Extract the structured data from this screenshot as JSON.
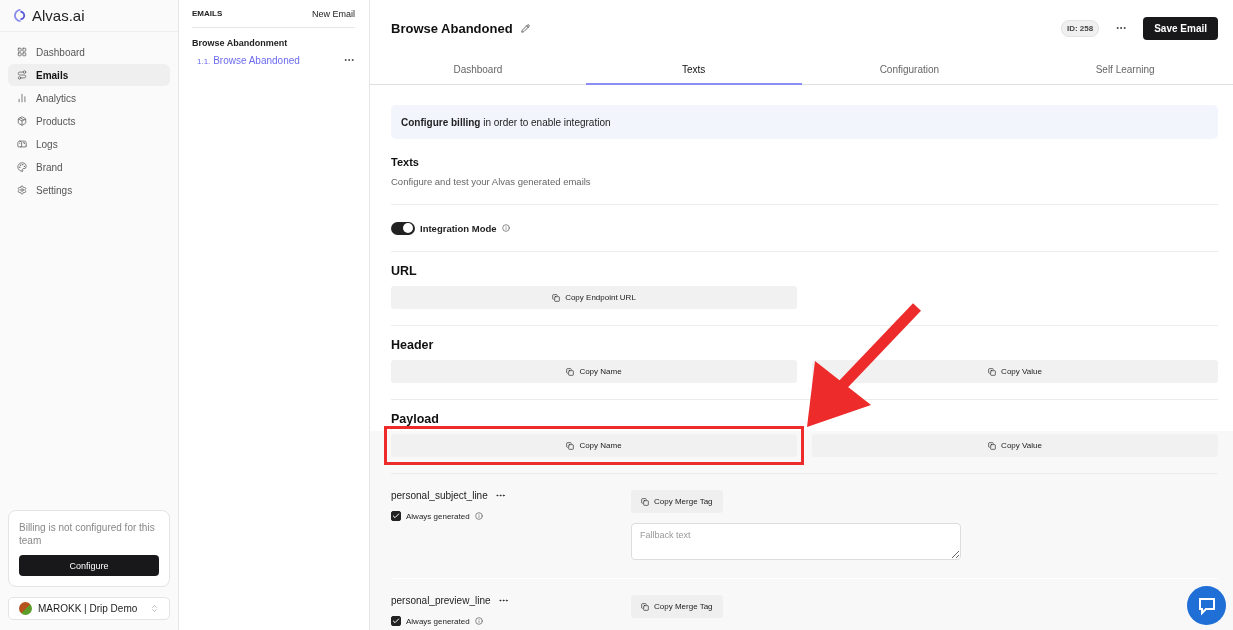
{
  "brand": {
    "name": "Alvas.ai"
  },
  "nav": [
    {
      "label": "Dashboard",
      "selected": false
    },
    {
      "label": "Emails",
      "selected": true
    },
    {
      "label": "Analytics",
      "selected": false
    },
    {
      "label": "Products",
      "selected": false
    },
    {
      "label": "Logs",
      "selected": false
    },
    {
      "label": "Brand",
      "selected": false
    },
    {
      "label": "Settings",
      "selected": false
    }
  ],
  "billing_card": {
    "text": "Billing is not configured for this team",
    "button": "Configure"
  },
  "team_switcher": {
    "name": "MAROKK | Drip Demo"
  },
  "emails_panel": {
    "title": "EMAILS",
    "new_button": "New Email",
    "groups": [
      {
        "name": "Browse Abandonment",
        "items": [
          {
            "number": "1.1.",
            "label": "Browse Abandoned",
            "selected": true
          }
        ]
      }
    ]
  },
  "header": {
    "title": "Browse Abandoned",
    "id_badge": "ID: 258",
    "save_button": "Save Email"
  },
  "tabs": [
    {
      "label": "Dashboard",
      "selected": false
    },
    {
      "label": "Texts",
      "selected": true
    },
    {
      "label": "Configuration",
      "selected": false
    },
    {
      "label": "Self Learning",
      "selected": false
    }
  ],
  "banner": {
    "text": "**Configure billing** in order to enable integration"
  },
  "texts_section": {
    "title": "Texts",
    "description": "Configure and test your Alvas generated emails"
  },
  "integration_mode": {
    "label": "Integration Mode",
    "on": true
  },
  "copy_sections": [
    {
      "title": "URL",
      "buttons": [
        "Copy Endpoint URL"
      ],
      "highlighted": false
    },
    {
      "title": "Header",
      "buttons": [
        "Copy Name",
        "Copy Value"
      ],
      "highlighted": false
    },
    {
      "title": "Payload",
      "buttons": [
        "Copy Name",
        "Copy Value"
      ],
      "highlighted": true
    }
  ],
  "fields": [
    {
      "name": "personal_subject_line",
      "always_generated": {
        "label": "Always generated",
        "checked": true
      },
      "merge_tag_button": "Copy Merge Tag",
      "fallback_placeholder": "Fallback text"
    },
    {
      "name": "personal_preview_line",
      "always_generated": {
        "label": "Always generated",
        "checked": true
      },
      "merge_tag_button": "Copy Merge Tag"
    }
  ]
}
